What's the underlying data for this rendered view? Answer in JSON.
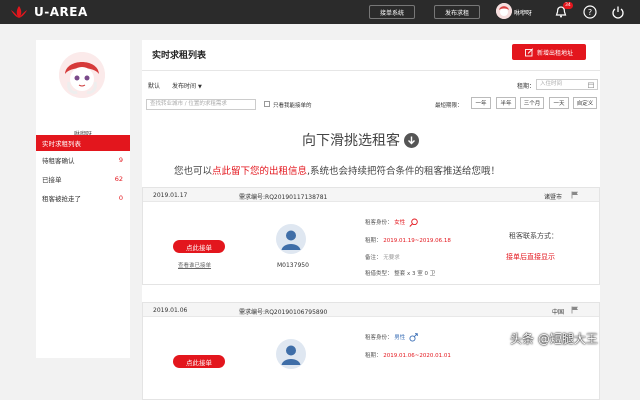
{
  "header": {
    "brand": "U-AREA",
    "nav_buttons": [
      "接单系统",
      "发布求租"
    ],
    "username": "咻咿呀",
    "badge_count": "34"
  },
  "sidebar": {
    "name": "咻咿呀",
    "items": [
      {
        "label": "实时求租列表",
        "count": ""
      },
      {
        "label": "待租客确认",
        "count": "9"
      },
      {
        "label": "已接单",
        "count": "62"
      },
      {
        "label": "租客被抢走了",
        "count": "0"
      }
    ]
  },
  "main": {
    "title": "实时求租列表",
    "add_button": "新增出租地址",
    "sort": {
      "default": "默认",
      "publish_time": "发布时间"
    },
    "rent_label": "租期：",
    "rent_placeholder": "入住时间",
    "search_placeholder": "查找转业城市 / 位置的求租需求",
    "checkbox_label": "只看我能接单的",
    "period_label": "最短期限：",
    "period_options": [
      "一年",
      "半年",
      "三个月",
      "一天",
      "自定义"
    ],
    "scroll_hint": "向下滑挑选租客",
    "notice": {
      "prefix": "您也可以",
      "highlight": "点此留下您的出租信息",
      "suffix": ",系统也会持续把符合条件的租客推送给您哦！"
    }
  },
  "cards": [
    {
      "date": "2019.01.17",
      "code": "需求编号:RQ20190117138781",
      "city": "诸暨市",
      "take_label": "点此接单",
      "link_label": "查看谁已接单",
      "user_id": "M0137950",
      "identity_label": "租客身份：",
      "identity_value": "女性",
      "gender": "female",
      "period_label": "租期：",
      "period_value": "2019.01.19~2019.06.18",
      "note_label": "备注：",
      "note_value": "无要求",
      "type_label": "租借类型：",
      "type_value": "整套 x 3 室 0 卫",
      "contact_label": "租客联系方式：",
      "contact_value": "接单后直接显示"
    },
    {
      "date": "2019.01.06",
      "code": "需求编号:RQ20190106795890",
      "city": "中国",
      "take_label": "点此接单",
      "link_label": "",
      "user_id": "",
      "identity_label": "租客身份：",
      "identity_value": "男性",
      "gender": "male",
      "period_label": "租期：",
      "period_value": "2019.01.06~2020.01.01",
      "note_label": "",
      "note_value": "",
      "type_label": "",
      "type_value": "",
      "contact_label": "",
      "contact_value": ""
    }
  ],
  "watermark": "头条 @短腿大王",
  "colors": {
    "accent": "#e3161d",
    "topbar": "#2b2b2b",
    "male": "#3b6fb6"
  }
}
